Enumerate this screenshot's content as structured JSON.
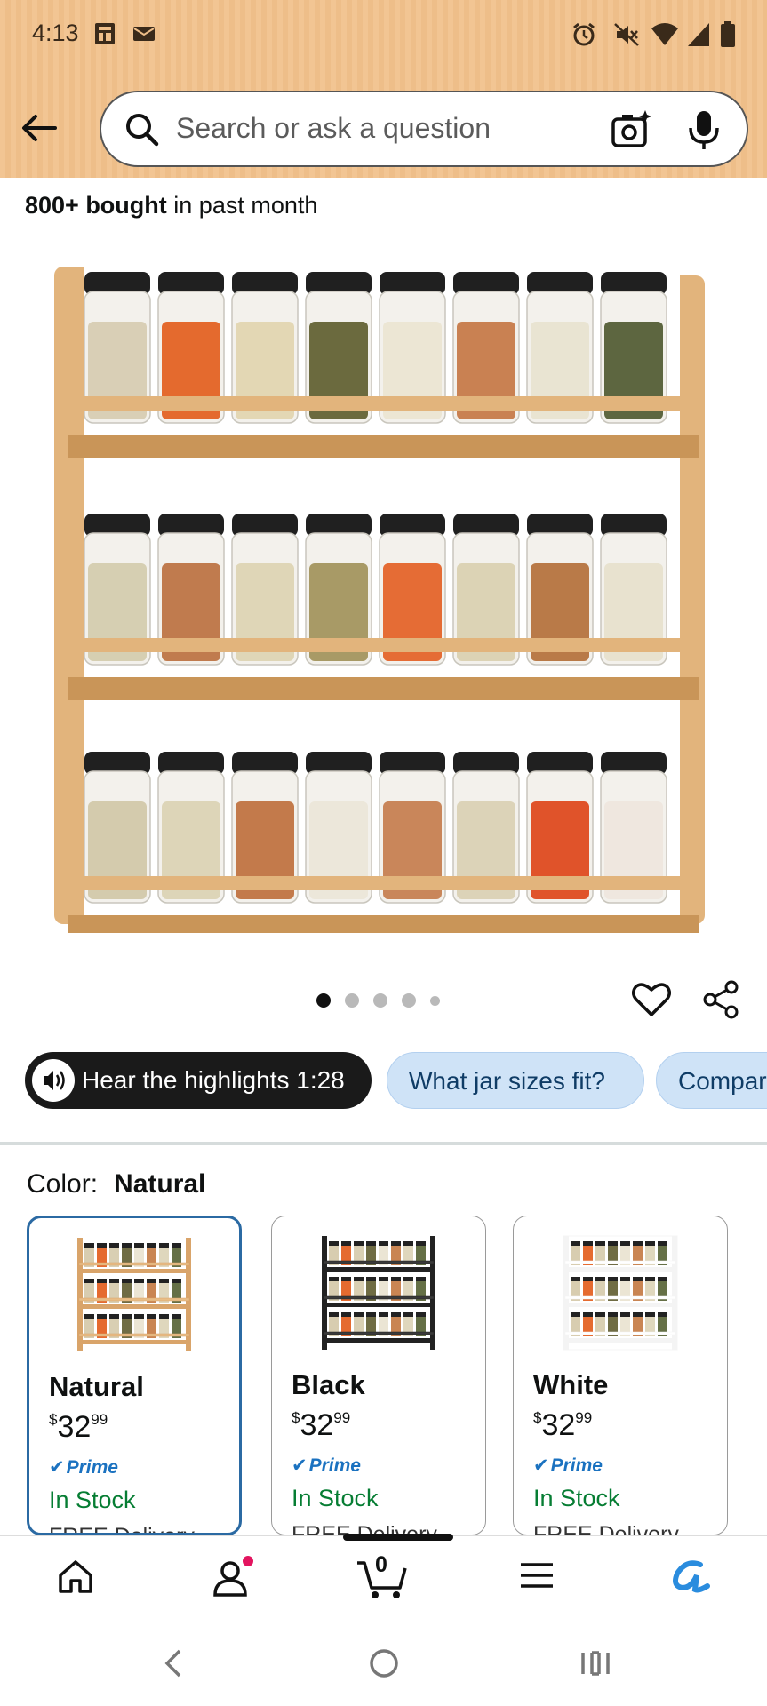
{
  "status_bar": {
    "time": "4:13"
  },
  "search": {
    "placeholder": "Search or ask a question"
  },
  "social_proof": {
    "bold": "800+ bought",
    "rest": " in past month"
  },
  "carousel": {
    "total": 5,
    "active_index": 0
  },
  "chips": [
    {
      "label": "Hear the highlights 1:28"
    },
    {
      "label": "What jar sizes fit?"
    },
    {
      "label": "Compar"
    }
  ],
  "color_selector": {
    "label": "Color:",
    "selected": "Natural",
    "options": [
      {
        "name": "Natural",
        "price_dollars": "32",
        "price_cents": "99",
        "prime": "Prime",
        "stock": "In Stock",
        "delivery": "FREE Delivery",
        "rack_color": "#d9a46a",
        "rail_color": "#e8bd86"
      },
      {
        "name": "Black",
        "price_dollars": "32",
        "price_cents": "99",
        "prime": "Prime",
        "stock": "In Stock",
        "delivery": "FREE Delivery",
        "rack_color": "#222222",
        "rail_color": "#3a3a3a"
      },
      {
        "name": "White",
        "price_dollars": "32",
        "price_cents": "99",
        "prime": "Prime",
        "stock": "In Stock",
        "delivery": "FREE Delivery",
        "rack_color": "#f4f4f4",
        "rail_color": "#ffffff"
      }
    ]
  },
  "bottom_nav": {
    "cart_count": "0"
  },
  "colors": {
    "header": "#f2c593",
    "accent_blue": "#2b6aa3",
    "in_stock": "#067d33",
    "prime": "#1b72c0"
  }
}
